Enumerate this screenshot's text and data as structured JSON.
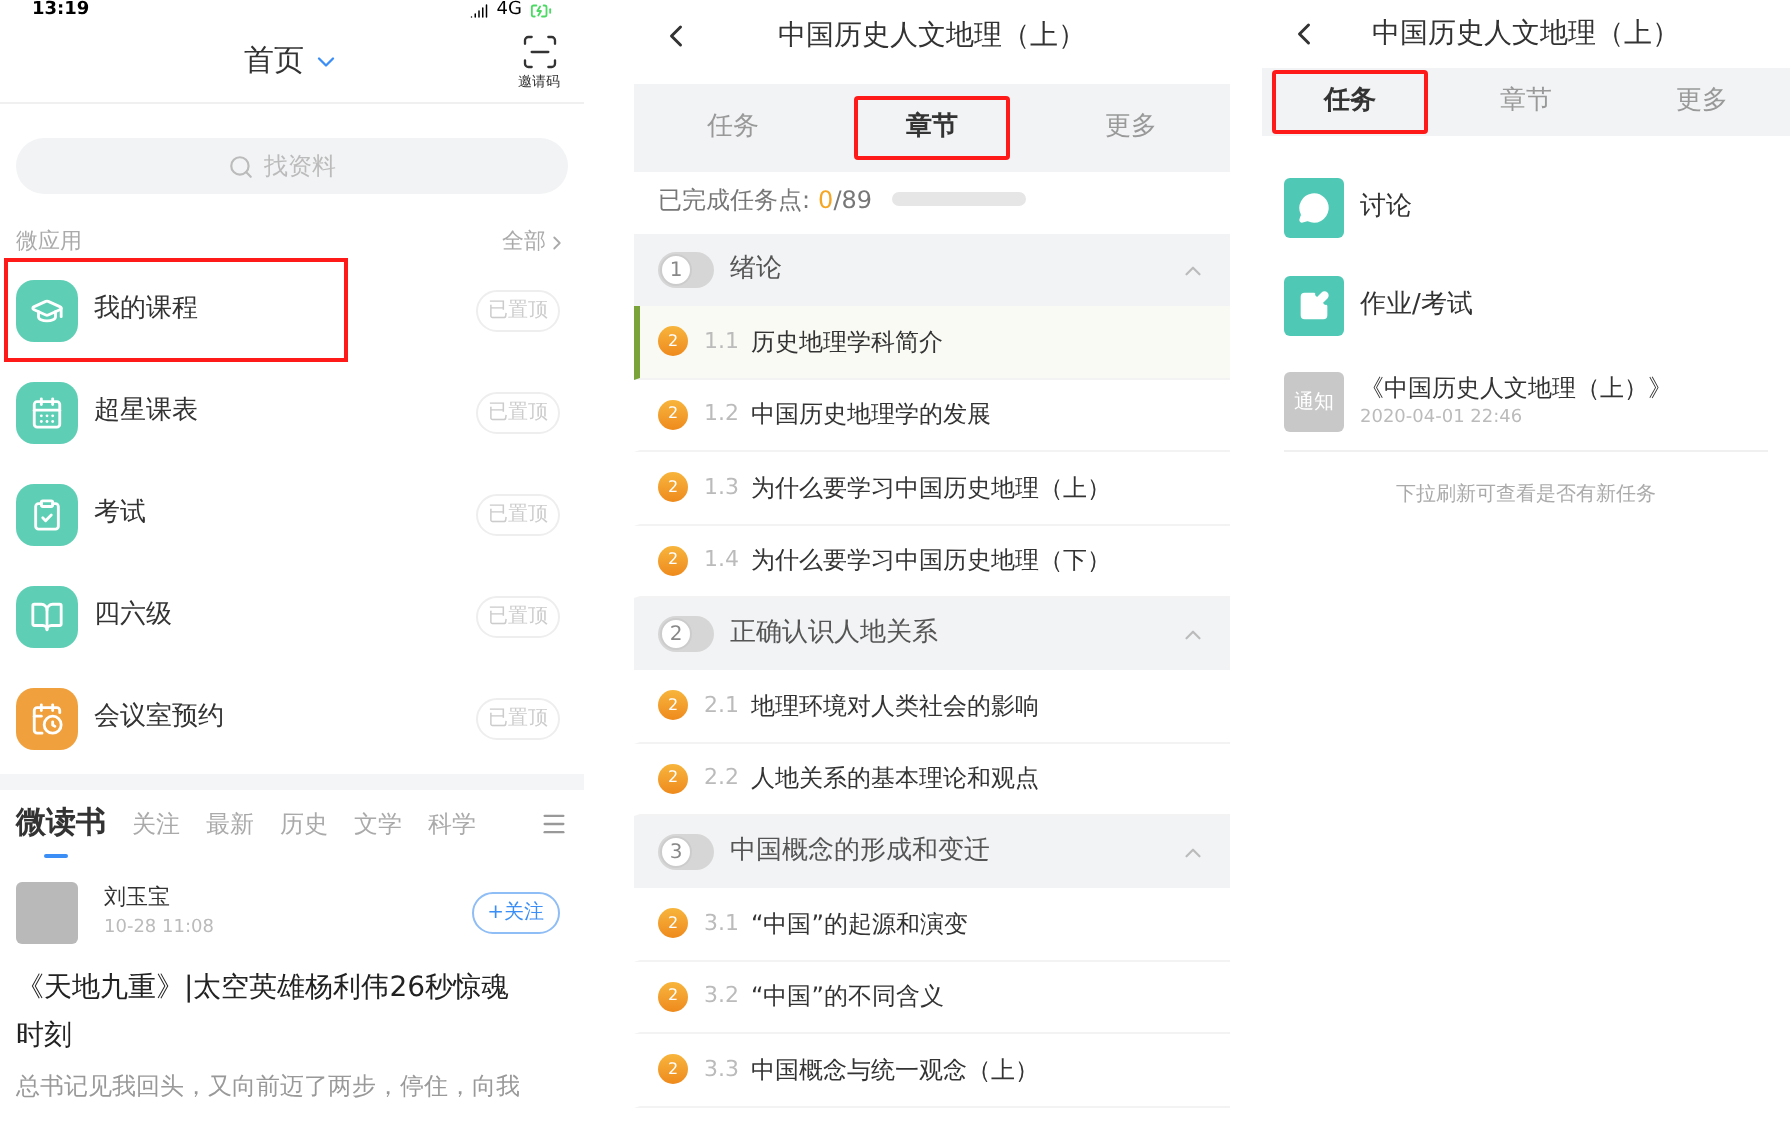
{
  "home": {
    "status": {
      "time": "13:19",
      "network": "4G"
    },
    "title": "首页",
    "scan_label": "邀请码",
    "search": {
      "placeholder": "找资料"
    },
    "section": {
      "label": "微应用",
      "link": "全部"
    },
    "apps": [
      {
        "kind": "course",
        "name": "我的课程",
        "color": "#5ecfb4",
        "badge": "已置顶",
        "highlighted": true
      },
      {
        "kind": "calendar",
        "name": "超星课表",
        "color": "#5ecfb4",
        "badge": "已置顶",
        "highlighted": false
      },
      {
        "kind": "exam",
        "name": "考试",
        "color": "#5ecfb4",
        "badge": "已置顶",
        "highlighted": false
      },
      {
        "kind": "cet",
        "name": "四六级",
        "color": "#5ecfb4",
        "badge": "已置顶",
        "highlighted": false
      },
      {
        "kind": "meeting",
        "name": "会议室预约",
        "color": "#f0a03c",
        "badge": "已置顶",
        "highlighted": false
      }
    ],
    "feed_tabs": [
      {
        "label": "微读书",
        "selected": true
      },
      {
        "label": "关注",
        "selected": false
      },
      {
        "label": "最新",
        "selected": false
      },
      {
        "label": "历史",
        "selected": false
      },
      {
        "label": "文学",
        "selected": false
      },
      {
        "label": "科学",
        "selected": false
      }
    ],
    "post": {
      "author": "刘玉宝",
      "time": "10-28 11:08",
      "follow": "+关注",
      "title": "《天地九重》|太空英雄杨利伟26秒惊魂时刻",
      "excerpt": "总书记见我回头，又向前迈了两步，停住，向我"
    }
  },
  "chapters_screen": {
    "title": "中国历史人文地理（上）",
    "tabs": [
      {
        "label": "任务",
        "selected": false,
        "highlighted": false
      },
      {
        "label": "章节",
        "selected": true,
        "highlighted": true
      },
      {
        "label": "更多",
        "selected": false,
        "highlighted": false
      }
    ],
    "progress": {
      "label": "已完成任务点:",
      "done": "0",
      "total": "/89",
      "level": 0
    },
    "chapters": [
      {
        "number": "1",
        "title": "绪论",
        "expanded": true,
        "children": [
          {
            "badge": "2",
            "number": "1.1",
            "title": "历史地理学科简介",
            "selected": true
          },
          {
            "badge": "2",
            "number": "1.2",
            "title": "中国历史地理学的发展",
            "selected": false
          },
          {
            "badge": "2",
            "number": "1.3",
            "title": "为什么要学习中国历史地理（上）",
            "selected": false
          },
          {
            "badge": "2",
            "number": "1.4",
            "title": "为什么要学习中国历史地理（下）",
            "selected": false
          }
        ]
      },
      {
        "number": "2",
        "title": "正确认识人地关系",
        "expanded": true,
        "children": [
          {
            "badge": "2",
            "number": "2.1",
            "title": "地理环境对人类社会的影响",
            "selected": false
          },
          {
            "badge": "2",
            "number": "2.2",
            "title": "人地关系的基本理论和观点",
            "selected": false
          }
        ]
      },
      {
        "number": "3",
        "title": "中国概念的形成和变迁",
        "expanded": true,
        "children": [
          {
            "badge": "2",
            "number": "3.1",
            "title": "“中国”的起源和演变",
            "selected": false
          },
          {
            "badge": "2",
            "number": "3.2",
            "title": "“中国”的不同含义",
            "selected": false
          },
          {
            "badge": "2",
            "number": "3.3",
            "title": "中国概念与统一观念（上）",
            "selected": false
          }
        ]
      }
    ]
  },
  "tasks_screen": {
    "title": "中国历史人文地理（上）",
    "tabs": [
      {
        "label": "任务",
        "selected": true,
        "highlighted": true
      },
      {
        "label": "章节",
        "selected": false,
        "highlighted": false
      },
      {
        "label": "更多",
        "selected": false,
        "highlighted": false
      }
    ],
    "items": [
      {
        "kind": "discussion",
        "label": "讨论"
      },
      {
        "kind": "homework",
        "label": "作业/考试"
      },
      {
        "kind": "notice",
        "icon_text": "通知",
        "label": "《中国历史人文地理（上）》",
        "time": "2020-04-01 22:46"
      }
    ],
    "hint": "下拉刷新可查看是否有新任务"
  }
}
